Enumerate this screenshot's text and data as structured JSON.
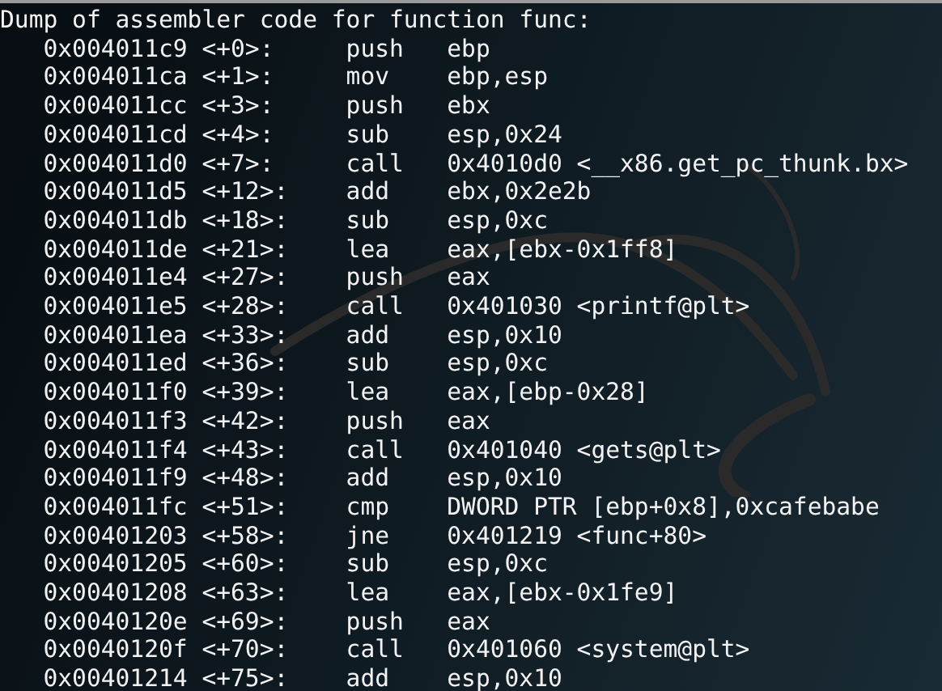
{
  "header": "Dump of assembler code for function func:",
  "lines": [
    {
      "address": "0x004011c9",
      "offset": "<+0>:",
      "mnemonic": "push",
      "operands": "ebp"
    },
    {
      "address": "0x004011ca",
      "offset": "<+1>:",
      "mnemonic": "mov",
      "operands": "ebp,esp"
    },
    {
      "address": "0x004011cc",
      "offset": "<+3>:",
      "mnemonic": "push",
      "operands": "ebx"
    },
    {
      "address": "0x004011cd",
      "offset": "<+4>:",
      "mnemonic": "sub",
      "operands": "esp,0x24"
    },
    {
      "address": "0x004011d0",
      "offset": "<+7>:",
      "mnemonic": "call",
      "operands": "0x4010d0 <__x86.get_pc_thunk.bx>"
    },
    {
      "address": "0x004011d5",
      "offset": "<+12>:",
      "mnemonic": "add",
      "operands": "ebx,0x2e2b"
    },
    {
      "address": "0x004011db",
      "offset": "<+18>:",
      "mnemonic": "sub",
      "operands": "esp,0xc"
    },
    {
      "address": "0x004011de",
      "offset": "<+21>:",
      "mnemonic": "lea",
      "operands": "eax,[ebx-0x1ff8]"
    },
    {
      "address": "0x004011e4",
      "offset": "<+27>:",
      "mnemonic": "push",
      "operands": "eax"
    },
    {
      "address": "0x004011e5",
      "offset": "<+28>:",
      "mnemonic": "call",
      "operands": "0x401030 <printf@plt>"
    },
    {
      "address": "0x004011ea",
      "offset": "<+33>:",
      "mnemonic": "add",
      "operands": "esp,0x10"
    },
    {
      "address": "0x004011ed",
      "offset": "<+36>:",
      "mnemonic": "sub",
      "operands": "esp,0xc"
    },
    {
      "address": "0x004011f0",
      "offset": "<+39>:",
      "mnemonic": "lea",
      "operands": "eax,[ebp-0x28]"
    },
    {
      "address": "0x004011f3",
      "offset": "<+42>:",
      "mnemonic": "push",
      "operands": "eax"
    },
    {
      "address": "0x004011f4",
      "offset": "<+43>:",
      "mnemonic": "call",
      "operands": "0x401040 <gets@plt>"
    },
    {
      "address": "0x004011f9",
      "offset": "<+48>:",
      "mnemonic": "add",
      "operands": "esp,0x10"
    },
    {
      "address": "0x004011fc",
      "offset": "<+51>:",
      "mnemonic": "cmp",
      "operands": "DWORD PTR [ebp+0x8],0xcafebabe"
    },
    {
      "address": "0x00401203",
      "offset": "<+58>:",
      "mnemonic": "jne",
      "operands": "0x401219 <func+80>"
    },
    {
      "address": "0x00401205",
      "offset": "<+60>:",
      "mnemonic": "sub",
      "operands": "esp,0xc"
    },
    {
      "address": "0x00401208",
      "offset": "<+63>:",
      "mnemonic": "lea",
      "operands": "eax,[ebx-0x1fe9]"
    },
    {
      "address": "0x0040120e",
      "offset": "<+69>:",
      "mnemonic": "push",
      "operands": "eax"
    },
    {
      "address": "0x0040120f",
      "offset": "<+70>:",
      "mnemonic": "call",
      "operands": "0x401060 <system@plt>"
    },
    {
      "address": "0x00401214",
      "offset": "<+75>:",
      "mnemonic": "add",
      "operands": "esp,0x10"
    }
  ]
}
